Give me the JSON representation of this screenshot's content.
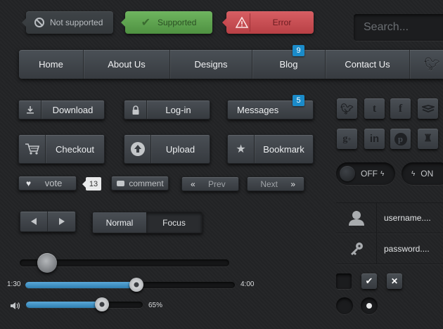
{
  "status_pills": {
    "not_supported": "Not supported",
    "supported": "Supported",
    "error": "Error"
  },
  "search": {
    "placeholder": "Search..."
  },
  "nav": {
    "items": [
      {
        "label": "Home"
      },
      {
        "label": "About Us"
      },
      {
        "label": "Designs"
      },
      {
        "label": "Blog",
        "badge": "9"
      },
      {
        "label": "Contact Us"
      }
    ]
  },
  "buttons": {
    "download": "Download",
    "login": "Log-in",
    "messages": "Messages",
    "messages_badge": "5",
    "checkout": "Checkout",
    "upload": "Upload",
    "bookmark": "Bookmark",
    "vote": "vote",
    "vote_count": "13",
    "comment": "comment",
    "prev": "Prev",
    "next": "Next"
  },
  "segmented": {
    "normal": "Normal",
    "focus": "Focus"
  },
  "social_icons": [
    "twitter-icon",
    "tumblr-icon",
    "facebook-icon",
    "dropbox-icon",
    "google-plus-icon",
    "linkedin-icon",
    "pinterest-icon",
    "stumbleupon-icon"
  ],
  "toggles": {
    "off_label": "OFF",
    "on_label": "ON"
  },
  "login_form": {
    "username_placeholder": "username....",
    "password_placeholder": "password...."
  },
  "media_player": {
    "current_time": "1:30",
    "total_time": "4:00",
    "progress": 0.53,
    "volume_label": "65%",
    "volume": 0.65
  },
  "plain_slider": {
    "value": 0.13
  },
  "colors": {
    "accent_blue": "#2f8fc9",
    "supported_green": "#5fa350",
    "error_red": "#c8494f",
    "background": "#232426"
  }
}
